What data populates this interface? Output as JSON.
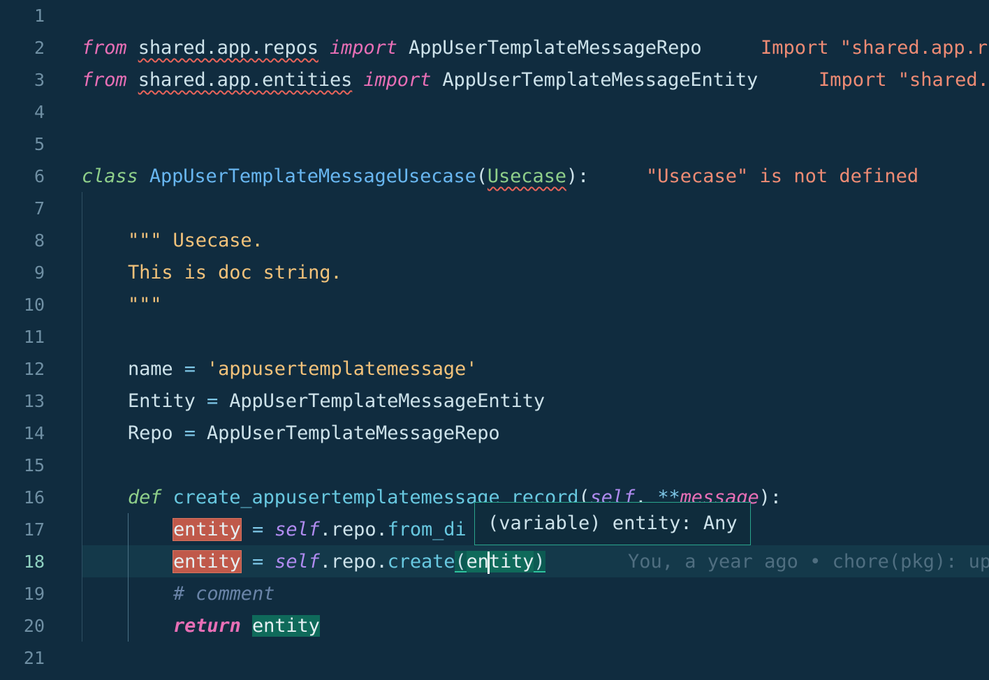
{
  "editor": {
    "line_numbers": [
      "1",
      "2",
      "3",
      "4",
      "5",
      "6",
      "7",
      "8",
      "9",
      "10",
      "11",
      "12",
      "13",
      "14",
      "15",
      "16",
      "17",
      "18",
      "19",
      "20",
      "21"
    ],
    "active_line": "18"
  },
  "code": {
    "l2": {
      "from": "from",
      "module": "shared.app.repos",
      "import": "import",
      "name": "AppUserTemplateMessageRepo",
      "error": "Import \"shared.app.r"
    },
    "l3": {
      "from": "from",
      "module": "shared.app.entities",
      "import": "import",
      "name": "AppUserTemplateMessageEntity",
      "error": "Import \"shared."
    },
    "l6": {
      "class": "class",
      "name": "AppUserTemplateMessageUsecase",
      "open": "(",
      "base": "Usecase",
      "close": "):",
      "error": "\"Usecase\" is not defined"
    },
    "l8": "\"\"\" Usecase.",
    "l9": "This is doc string.",
    "l10": "\"\"\"",
    "l12": {
      "name": "name",
      "eq": "=",
      "value": "'appusertemplatemessage'"
    },
    "l13": {
      "name": "Entity",
      "eq": "=",
      "value": "AppUserTemplateMessageEntity"
    },
    "l14": {
      "name": "Repo",
      "eq": "=",
      "value": "AppUserTemplateMessageRepo"
    },
    "l16": {
      "def": "def",
      "fn": "create_appusertemplatemessage_record",
      "open": "(",
      "self": "self",
      "sep": ", ",
      "stars": "**",
      "param": "message",
      "close": "):"
    },
    "l17": {
      "var": "entity",
      "eq": "=",
      "self": "self",
      "attr": ".repo.",
      "method": "from_di"
    },
    "l18": {
      "var": "entity",
      "eq": "=",
      "self": "self",
      "attr": ".repo.",
      "method": "create",
      "open": "(",
      "arg_a": "en",
      "arg_b": "tity",
      "close": ")",
      "blame": "You, a year ago • chore(pkg): up"
    },
    "l19": "# comment",
    "l20": {
      "return": "return",
      "var": "entity"
    }
  },
  "hover": {
    "text": "(variable) entity: Any"
  }
}
